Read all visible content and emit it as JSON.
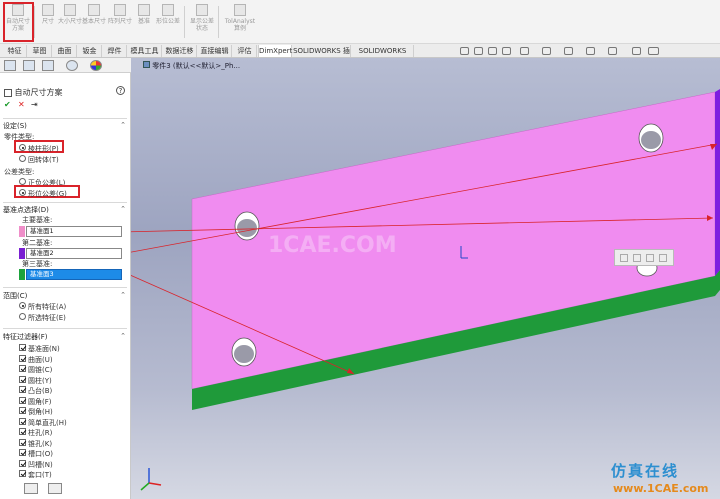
{
  "toolbar": {
    "buttons": [
      "自动尺寸方案",
      "尺寸",
      "大小尺寸",
      "基本尺寸",
      "阵列尺寸",
      "基准",
      "形位公差",
      "显示公差状态",
      "TolAnalyst算例"
    ]
  },
  "tabs": [
    "特征",
    "草图",
    "曲面",
    "钣金",
    "焊件",
    "模具工具",
    "数据迁移",
    "直接编辑",
    "评估",
    "DimXpert",
    "SOLIDWORKS 插件",
    "SOLIDWORKS MBD"
  ],
  "active_tab": "DimXpert",
  "panel": {
    "title": "自动尺寸方案",
    "help": "?",
    "ok": "✔",
    "cancel": "✕",
    "pin": "⇥",
    "settings": {
      "header": "设定(S)",
      "part_type_label": "零件类型:",
      "prismatic": "棱柱形(P)",
      "turned": "回转体(T)",
      "tolerance_type_label": "公差类型:",
      "plus_minus": "正负公差(L)",
      "geometric": "形位公差(G)"
    },
    "datum": {
      "header": "基准点选择(D)",
      "primary_label": "主要基准:",
      "primary_value": "基准面1",
      "secondary_label": "第二基准:",
      "secondary_value": "基准面2",
      "tertiary_label": "第三基准:",
      "tertiary_value": "基准面3"
    },
    "scope": {
      "header": "范围(C)",
      "all": "所有特征(A)",
      "selected": "所选特征(E)"
    },
    "filters": {
      "header": "特征过滤器(F)",
      "items": [
        "基准面(N)",
        "曲面(U)",
        "圆锥(C)",
        "圆柱(Y)",
        "凸台(B)",
        "圆角(F)",
        "倒角(H)",
        "简单直孔(H)",
        "柱孔(R)",
        "锥孔(K)",
        "槽口(O)",
        "凹槽(N)",
        "套口(T)"
      ]
    }
  },
  "viewport": {
    "breadcrumb": "零件3 (默认<<默认>_Ph..."
  },
  "watermark": {
    "center": "1CAE.COM",
    "brand": "仿真在线",
    "url": "www.1CAE.com"
  },
  "colors": {
    "plate_top": "#f08cf0",
    "plate_front": "#1f9a3a",
    "plate_side": "#7f1ee0",
    "swatch_primary": "#ef8ec9",
    "swatch_secondary": "#7a1fd2",
    "swatch_tertiary": "#1da33d",
    "selected_field": "#1d8be8",
    "highlight_red": "#d9232a"
  }
}
